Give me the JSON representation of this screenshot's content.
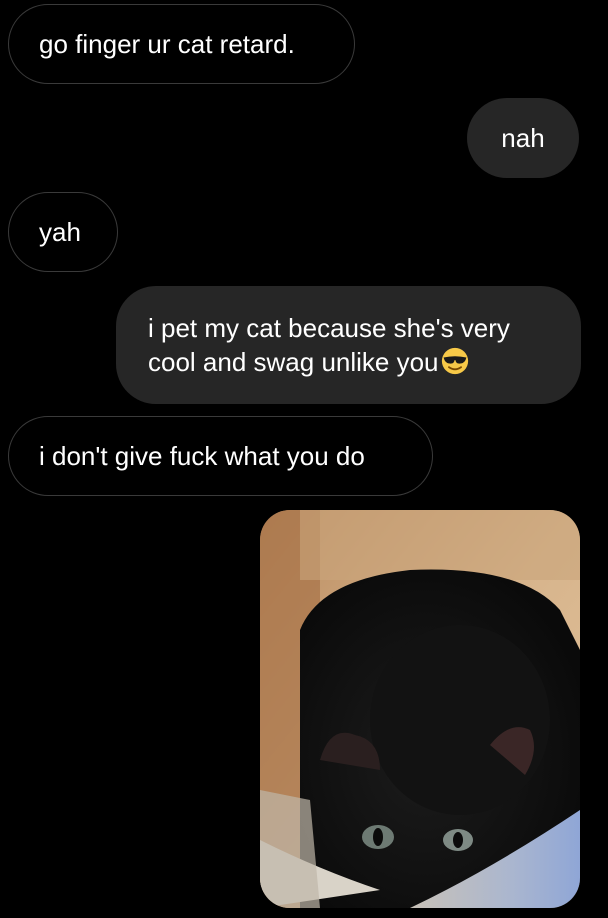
{
  "messages": [
    {
      "side": "incoming",
      "text": "go finger ur cat retard."
    },
    {
      "side": "outgoing",
      "text": "nah"
    },
    {
      "side": "incoming",
      "text": "yah"
    },
    {
      "side": "outgoing",
      "text": "i pet my cat because she's very cool and swag unlike you",
      "emoji": "smiling-face-with-sunglasses-icon"
    },
    {
      "side": "incoming",
      "text": "i don't give fuck what you do"
    },
    {
      "side": "outgoing",
      "type": "photo",
      "content": "black-cat-photo"
    }
  ],
  "colors": {
    "background": "#000000",
    "outgoing_bubble": "#262626",
    "incoming_border": "#3a3a3a",
    "text": "#ffffff"
  }
}
